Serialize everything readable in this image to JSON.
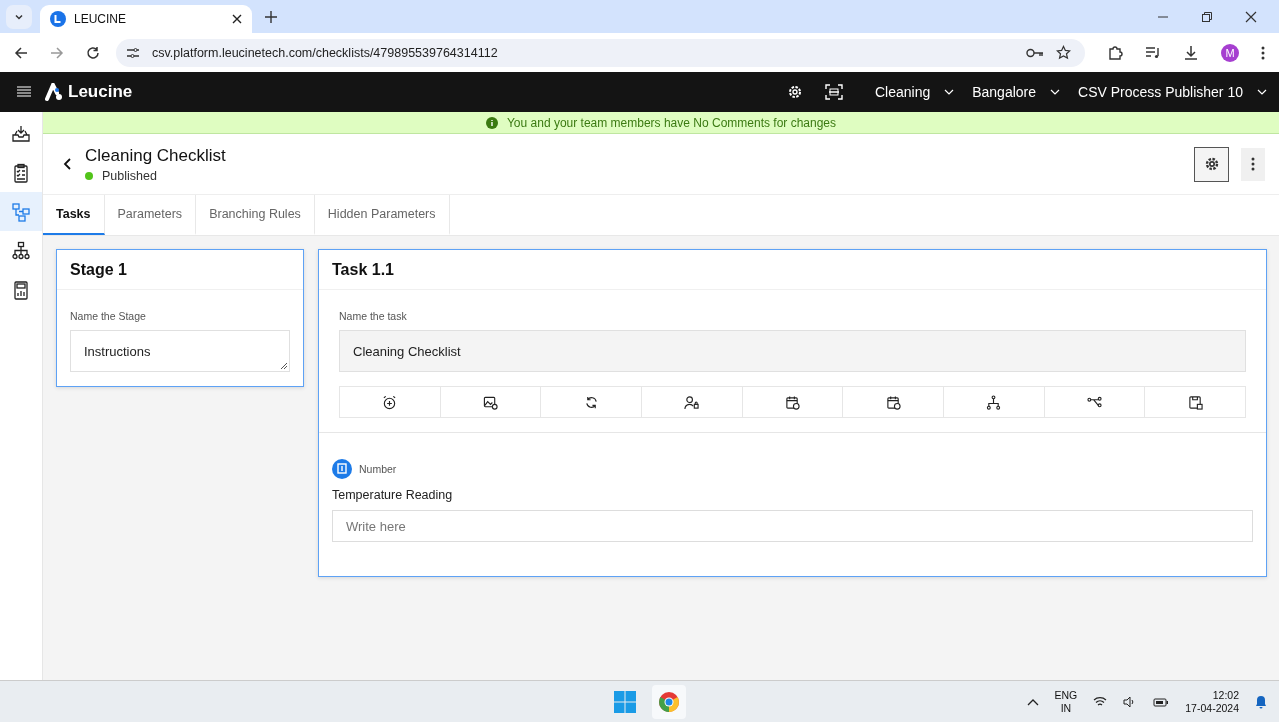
{
  "browser": {
    "tab_title": "LEUCINE",
    "url": "csv.platform.leucinetech.com/checklists/479895539764314112",
    "avatar": "M"
  },
  "header": {
    "logo": "Leucine",
    "dropdowns": [
      "Cleaning",
      "Bangalore",
      "CSV Process Publisher 10"
    ]
  },
  "banner": "You and your team members have No Comments for changes",
  "sidebar": {
    "items": [
      {
        "selected": false
      },
      {
        "selected": false
      },
      {
        "selected": true
      },
      {
        "selected": false
      },
      {
        "selected": false
      }
    ]
  },
  "checklist": {
    "title": "Cleaning Checklist",
    "status": "Published"
  },
  "tabs": [
    {
      "label": "Tasks",
      "selected": true
    },
    {
      "label": "Parameters",
      "selected": false
    },
    {
      "label": "Branching Rules",
      "selected": false
    },
    {
      "label": "Hidden Parameters",
      "selected": false
    }
  ],
  "stage": {
    "title": "Stage 1",
    "field_label": "Name the Stage",
    "value": "Instructions"
  },
  "task": {
    "title": "Task 1.1",
    "field_label": "Name the task",
    "value": "Cleaning Checklist",
    "parameter": {
      "type": "Number",
      "label": "Temperature Reading",
      "placeholder": "Write here"
    }
  },
  "taskbar": {
    "language": "ENG",
    "region": "IN",
    "time": "12:02",
    "date": "17-04-2024"
  }
}
